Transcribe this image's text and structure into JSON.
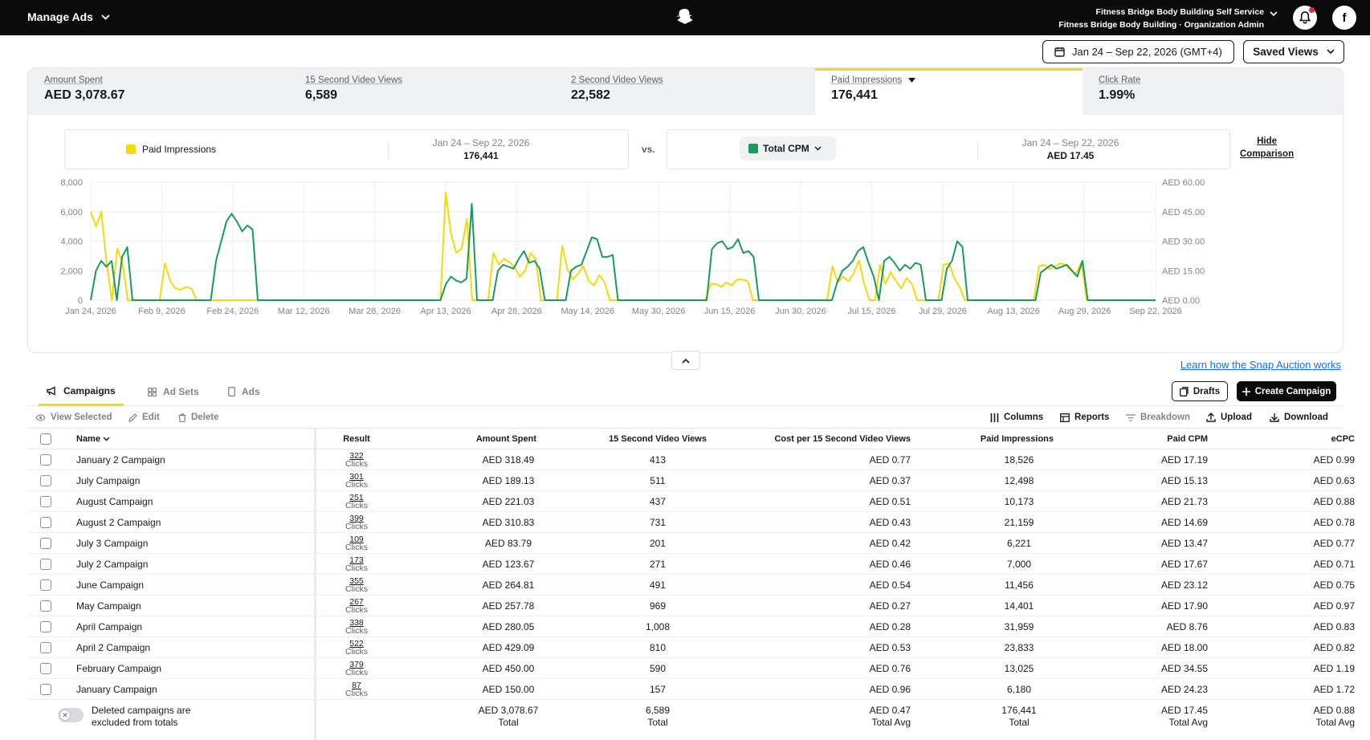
{
  "topbar": {
    "manage_label": "Manage Ads",
    "org_line1": "Fitness Bridge Body Building Self Service",
    "org_line2": "Fitness Bridge Body Building · Organization Admin",
    "avatar_letter": "f"
  },
  "date_range": "Jan 24 – Sep 22, 2026 (GMT+4)",
  "saved_views": "Saved Views",
  "metrics": [
    {
      "label": "Amount Spent",
      "value": "AED 3,078.67"
    },
    {
      "label": "15 Second Video Views",
      "value": "6,589"
    },
    {
      "label": "2 Second Video Views",
      "value": "22,582"
    },
    {
      "label": "Paid Impressions",
      "value": "176,441"
    },
    {
      "label": "Click Rate",
      "value": "1.99%"
    }
  ],
  "comparison": {
    "left_label": "Paid Impressions",
    "left_date": "Jan 24 – Sep 22, 2026",
    "left_value": "176,441",
    "vs": "vs.",
    "right_label": "Total CPM",
    "right_date": "Jan 24 – Sep 22, 2026",
    "right_value": "AED 17.45",
    "hide_line1": "Hide",
    "hide_line2": "Comparison"
  },
  "colors": {
    "impressions": "#f5d90a",
    "cpm": "#1a9a5c",
    "accent": "#f5d90a",
    "link": "#1a6fd4"
  },
  "chart_data": {
    "type": "line",
    "x_tick_labels": [
      "Jan 24, 2026",
      "Feb 9, 2026",
      "Feb 24, 2026",
      "Mar 12, 2026",
      "Mar 28, 2026",
      "Apr 13, 2026",
      "Apr 28, 2026",
      "May 14, 2026",
      "May 30, 2026",
      "Jun 15, 2026",
      "Jun 30, 2026",
      "Jul 15, 2026",
      "Jul 29, 2026",
      "Aug 13, 2026",
      "Aug 29, 2026",
      "Sep 22, 2026"
    ],
    "y_left_ticks": [
      "8,000",
      "6,000",
      "4,000",
      "2,000",
      "0"
    ],
    "y_right_ticks": [
      "AED 60.00",
      "AED 45.00",
      "AED 30.00",
      "AED 15.00",
      "AED 0.00"
    ],
    "ylim_left": [
      0,
      8000
    ],
    "ylim_right": [
      0,
      60
    ],
    "grid": true,
    "series": [
      {
        "name": "Paid Impressions",
        "axis": "left",
        "values": [
          6000,
          5000,
          6000,
          2500,
          0,
          3500,
          2500,
          0,
          0,
          0,
          0,
          0,
          0,
          0,
          2500,
          1300,
          800,
          700,
          900,
          800,
          0,
          0,
          0,
          0,
          0,
          0,
          0,
          0,
          0,
          0,
          0,
          0,
          0,
          0,
          0,
          0,
          0,
          0,
          0,
          0,
          0,
          0,
          0,
          0,
          0,
          0,
          0,
          0,
          0,
          0,
          0,
          0,
          0,
          0,
          0,
          0,
          0,
          0,
          0,
          0,
          0,
          0,
          0,
          0,
          0,
          0,
          0,
          7300,
          4500,
          3200,
          3500,
          5500,
          0,
          0,
          0,
          0,
          3200,
          2400,
          2800,
          2600,
          2200,
          1600,
          2000,
          3200,
          2800,
          0,
          0,
          0,
          0,
          3700,
          2100,
          1400,
          1800,
          2300,
          1300,
          1000,
          1700,
          1200,
          0,
          0,
          0,
          0,
          0,
          0,
          0,
          0,
          0,
          0,
          0,
          0,
          0,
          0,
          0,
          0,
          0,
          0,
          0,
          1100,
          1100,
          900,
          1200,
          1000,
          1400,
          1400,
          1300,
          0,
          0,
          0,
          0,
          0,
          0,
          0,
          0,
          0,
          0,
          0,
          0,
          0,
          0,
          0,
          2300,
          1200,
          1600,
          1300,
          1800,
          2700,
          1100,
          0,
          0,
          2400,
          1100,
          1900,
          1300,
          800,
          1500,
          1100,
          0,
          0,
          0,
          0,
          0,
          2400,
          2500,
          1500,
          900,
          0,
          0,
          0,
          0,
          0,
          0,
          0,
          0,
          0,
          0,
          0,
          0,
          0,
          0,
          2300,
          2400,
          2100,
          2300,
          2500,
          2400,
          2000,
          1800,
          2600,
          0,
          0,
          0,
          0,
          0,
          0,
          0,
          0,
          0,
          0,
          0,
          0,
          0,
          0
        ]
      },
      {
        "name": "Total CPM",
        "axis": "right",
        "values": [
          0,
          15,
          20,
          17,
          20,
          0,
          22,
          27,
          0,
          0,
          0,
          0,
          0,
          0,
          0,
          0,
          0,
          0,
          0,
          0,
          0,
          0,
          0,
          0,
          20,
          30,
          40,
          44,
          40,
          35,
          38,
          36,
          0,
          0,
          0,
          0,
          0,
          0,
          0,
          0,
          0,
          0,
          0,
          0,
          0,
          0,
          0,
          0,
          0,
          0,
          0,
          0,
          0,
          0,
          0,
          0,
          0,
          0,
          0,
          0,
          0,
          0,
          0,
          0,
          0,
          0,
          0,
          0,
          8,
          12,
          10,
          9,
          11,
          49,
          0,
          0,
          0,
          0,
          15,
          18,
          17,
          16,
          21,
          25,
          19,
          20,
          16,
          0,
          0,
          0,
          0,
          0,
          15,
          17,
          18,
          25,
          32,
          31,
          22,
          22,
          23,
          0,
          0,
          0,
          0,
          0,
          0,
          0,
          0,
          0,
          0,
          0,
          0,
          0,
          0,
          0,
          0,
          0,
          0,
          26,
          29,
          30,
          26,
          27,
          31,
          24,
          25,
          22,
          0,
          0,
          0,
          0,
          0,
          0,
          0,
          0,
          0,
          0,
          0,
          0,
          0,
          0,
          0,
          9,
          15,
          17,
          20,
          25,
          27,
          19,
          12,
          0,
          20,
          22,
          19,
          15,
          18,
          16,
          19,
          18,
          0,
          0,
          0,
          0,
          16,
          20,
          30,
          27,
          0,
          0,
          0,
          0,
          0,
          0,
          0,
          0,
          0,
          0,
          0,
          0,
          0,
          0,
          14,
          16,
          18,
          16,
          17,
          18,
          15,
          12,
          20,
          0,
          0,
          0,
          0,
          0,
          0,
          0,
          0,
          0,
          0,
          0,
          0,
          0,
          0
        ]
      }
    ]
  },
  "learn_link": "Learn how the Snap Auction works",
  "tabs": [
    "Campaigns",
    "Ad Sets",
    "Ads"
  ],
  "drafts_label": "Drafts",
  "create_label": "Create Campaign",
  "toolbar": {
    "view_selected": "View Selected",
    "edit": "Edit",
    "delete": "Delete",
    "columns": "Columns",
    "reports": "Reports",
    "breakdown": "Breakdown",
    "upload": "Upload",
    "download": "Download"
  },
  "table": {
    "headers": [
      "Name",
      "Result",
      "Amount Spent",
      "15 Second Video Views",
      "Cost per 15 Second Video Views",
      "Paid Impressions",
      "Paid CPM",
      "eCPC"
    ],
    "result_unit": "Clicks",
    "rows": [
      {
        "name": "January 2 Campaign",
        "result": "322",
        "spent": "AED 318.49",
        "views": "413",
        "cost": "AED 0.77",
        "impr": "18,526",
        "cpm": "AED 17.19",
        "ecpc": "AED 0.99"
      },
      {
        "name": "July Campaign",
        "result": "301",
        "spent": "AED 189.13",
        "views": "511",
        "cost": "AED 0.37",
        "impr": "12,498",
        "cpm": "AED 15.13",
        "ecpc": "AED 0.63"
      },
      {
        "name": "August Campaign",
        "result": "251",
        "spent": "AED 221.03",
        "views": "437",
        "cost": "AED 0.51",
        "impr": "10,173",
        "cpm": "AED 21.73",
        "ecpc": "AED 0.88"
      },
      {
        "name": "August 2 Campaign",
        "result": "399",
        "spent": "AED 310.83",
        "views": "731",
        "cost": "AED 0.43",
        "impr": "21,159",
        "cpm": "AED 14.69",
        "ecpc": "AED 0.78"
      },
      {
        "name": "July 3 Campaign",
        "result": "109",
        "spent": "AED 83.79",
        "views": "201",
        "cost": "AED 0.42",
        "impr": "6,221",
        "cpm": "AED 13.47",
        "ecpc": "AED 0.77"
      },
      {
        "name": "July 2 Campaign",
        "result": "173",
        "spent": "AED 123.67",
        "views": "271",
        "cost": "AED 0.46",
        "impr": "7,000",
        "cpm": "AED 17.67",
        "ecpc": "AED 0.71"
      },
      {
        "name": "June Campaign",
        "result": "355",
        "spent": "AED 264.81",
        "views": "491",
        "cost": "AED 0.54",
        "impr": "11,456",
        "cpm": "AED 23.12",
        "ecpc": "AED 0.75"
      },
      {
        "name": "May Campaign",
        "result": "267",
        "spent": "AED 257.78",
        "views": "969",
        "cost": "AED 0.27",
        "impr": "14,401",
        "cpm": "AED 17.90",
        "ecpc": "AED 0.97"
      },
      {
        "name": "April Campaign",
        "result": "338",
        "spent": "AED 280.05",
        "views": "1,008",
        "cost": "AED 0.28",
        "impr": "31,959",
        "cpm": "AED 8.76",
        "ecpc": "AED 0.83"
      },
      {
        "name": "April 2 Campaign",
        "result": "522",
        "spent": "AED 429.09",
        "views": "810",
        "cost": "AED 0.53",
        "impr": "23,833",
        "cpm": "AED 18.00",
        "ecpc": "AED 0.82"
      },
      {
        "name": "February Campaign",
        "result": "379",
        "spent": "AED 450.00",
        "views": "590",
        "cost": "AED 0.76",
        "impr": "13,025",
        "cpm": "AED 34.55",
        "ecpc": "AED 1.19"
      },
      {
        "name": "January Campaign",
        "result": "87",
        "spent": "AED 150.00",
        "views": "157",
        "cost": "AED 0.96",
        "impr": "6,180",
        "cpm": "AED 24.23",
        "ecpc": "AED 1.72"
      }
    ],
    "totals": {
      "deleted_note_1": "Deleted campaigns are",
      "deleted_note_2": "excluded from totals",
      "spent": "AED 3,078.67",
      "spent_sub": "Total",
      "views": "6,589",
      "views_sub": "Total",
      "cost": "AED 0.47",
      "cost_sub": "Total Avg",
      "impr": "176,441",
      "impr_sub": "Total",
      "cpm": "AED 17.45",
      "cpm_sub": "Total Avg",
      "ecpc": "AED 0.88",
      "ecpc_sub": "Total Avg"
    }
  }
}
